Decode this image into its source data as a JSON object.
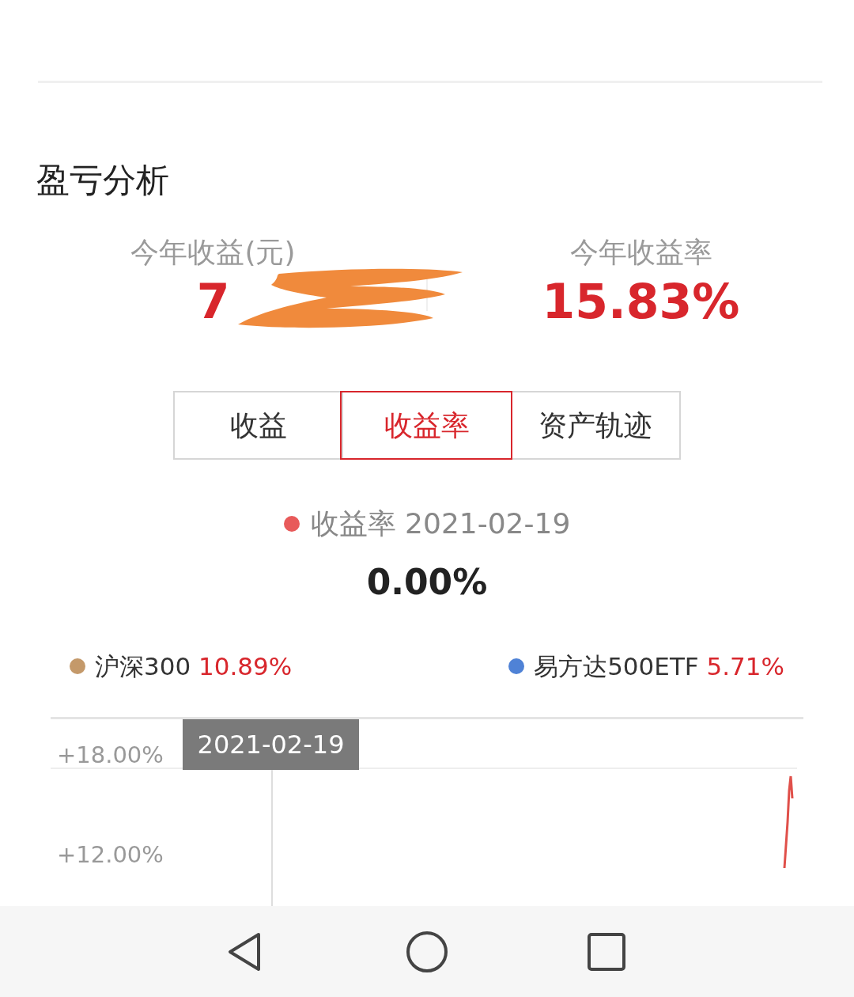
{
  "section_title": "盈亏分析",
  "stats": [
    {
      "label": "今年收益(元)",
      "value": "7",
      "redacted": true
    },
    {
      "label": "今年收益率",
      "value": "15.83%",
      "redacted": false
    }
  ],
  "tabs": [
    {
      "label": "收益",
      "selected": false
    },
    {
      "label": "收益率",
      "selected": true
    },
    {
      "label": "资产轨迹",
      "selected": false
    }
  ],
  "selection": {
    "series": "收益率",
    "date": "2021-02-19",
    "value": "0.00%"
  },
  "legend": [
    {
      "name": "沪深300",
      "value": "10.89%",
      "color": "#c4996a"
    },
    {
      "name": "易方达500ETF",
      "value": "5.71%",
      "color": "#4f82d6"
    }
  ],
  "chart": {
    "tooltip": "2021-02-19",
    "y_labels": [
      "+18.00%",
      "+12.00%"
    ]
  },
  "nav_buttons": [
    {
      "kind": "back"
    },
    {
      "kind": "home"
    },
    {
      "kind": "recent"
    }
  ]
}
